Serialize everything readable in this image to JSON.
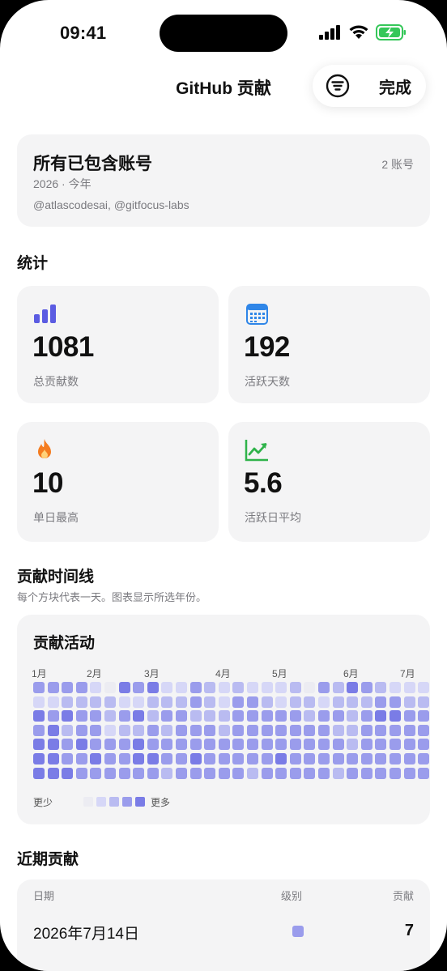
{
  "status": {
    "time": "09:41"
  },
  "nav": {
    "title": "GitHub 贡献",
    "done_label": "完成",
    "filter_icon": "filter-icon"
  },
  "account": {
    "title": "所有已包含账号",
    "count_label": "2 账号",
    "year_label": "2026 · 今年",
    "users": "@atlascodesai, @gitfocus-labs"
  },
  "stats": {
    "section_title": "统计",
    "items": [
      {
        "value": "1081",
        "label": "总贡献数",
        "icon": "bar-chart-icon",
        "color": "#5b5ce2"
      },
      {
        "value": "192",
        "label": "活跃天数",
        "icon": "calendar-icon",
        "color": "#2f86e8"
      },
      {
        "value": "10",
        "label": "单日最高",
        "icon": "flame-icon",
        "color": "#f47c20"
      },
      {
        "value": "5.6",
        "label": "活跃日平均",
        "icon": "trend-up-icon",
        "color": "#2fb34a"
      }
    ]
  },
  "timeline": {
    "section_title": "贡献时间线",
    "subtitle": "每个方块代表一天。图表显示所选年份。",
    "card_title": "贡献活动",
    "months": [
      "1月",
      "2月",
      "3月",
      "4月",
      "5月",
      "6月",
      "7月"
    ],
    "legend_less": "更少",
    "legend_more": "更多",
    "levels": [
      "#ececf2",
      "#d6d7f7",
      "#b9bbf1",
      "#9a9cec",
      "#7a7ce6"
    ],
    "columns": [
      [
        3,
        1,
        4,
        3,
        4,
        4,
        4
      ],
      [
        3,
        1,
        3,
        4,
        4,
        4,
        4
      ],
      [
        3,
        2,
        4,
        2,
        3,
        3,
        4
      ],
      [
        3,
        2,
        3,
        3,
        4,
        3,
        3
      ],
      [
        1,
        2,
        3,
        3,
        3,
        4,
        3
      ],
      [
        0,
        2,
        2,
        1,
        3,
        3,
        3
      ],
      [
        4,
        1,
        3,
        2,
        3,
        3,
        3
      ],
      [
        3,
        1,
        4,
        2,
        4,
        4,
        3
      ],
      [
        4,
        2,
        2,
        3,
        3,
        4,
        3
      ],
      [
        1,
        2,
        3,
        2,
        3,
        3,
        2
      ],
      [
        1,
        2,
        3,
        3,
        3,
        3,
        3
      ],
      [
        3,
        3,
        2,
        3,
        3,
        4,
        3
      ],
      [
        2,
        2,
        2,
        3,
        3,
        3,
        3
      ],
      [
        1,
        1,
        2,
        2,
        3,
        3,
        3
      ],
      [
        2,
        3,
        3,
        3,
        3,
        3,
        3
      ],
      [
        1,
        3,
        3,
        3,
        3,
        3,
        2
      ],
      [
        1,
        2,
        3,
        3,
        3,
        3,
        3
      ],
      [
        1,
        1,
        3,
        3,
        3,
        4,
        3
      ],
      [
        2,
        2,
        3,
        3,
        3,
        3,
        3
      ],
      [
        0,
        2,
        2,
        3,
        3,
        3,
        3
      ],
      [
        3,
        1,
        3,
        3,
        3,
        3,
        3
      ],
      [
        2,
        2,
        3,
        2,
        3,
        3,
        2
      ],
      [
        4,
        2,
        2,
        2,
        2,
        3,
        3
      ],
      [
        3,
        2,
        3,
        3,
        3,
        3,
        3
      ],
      [
        2,
        3,
        4,
        3,
        3,
        3,
        3
      ],
      [
        1,
        3,
        4,
        3,
        3,
        3,
        3
      ],
      [
        1,
        2,
        3,
        3,
        3,
        3,
        3
      ],
      [
        1,
        2,
        3,
        3,
        3,
        3,
        3
      ]
    ]
  },
  "recent": {
    "section_title": "近期贡献",
    "headers": {
      "date": "日期",
      "level": "级别",
      "count": "贡献"
    },
    "rows": [
      {
        "date": "2026年7月14日",
        "level": 3,
        "count": "7"
      }
    ]
  }
}
